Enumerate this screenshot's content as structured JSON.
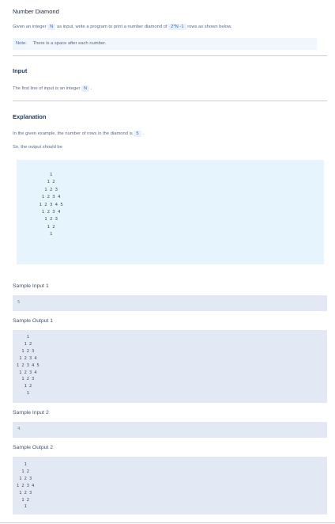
{
  "problem": {
    "title": "Number Diamond",
    "desc_prefix": "Given an integer",
    "desc_var": "N",
    "desc_middle": "as input, write a program to print a number diamond of",
    "desc_formula": "2*N -1",
    "desc_suffix": "rows as shown below.",
    "note_label": "Note:",
    "note_text": "There is a space after each number."
  },
  "input_section": {
    "heading": "Input",
    "text_prefix": "The first line of input is an integer",
    "text_var": "N",
    "text_suffix": "."
  },
  "explanation": {
    "heading": "Explanation",
    "line1_prefix": "In the given example, the number of rows in the diamond is",
    "line1_value": "5",
    "line1_suffix": ".",
    "line2": "So, the output should be",
    "diamond": "        1\n       1 2\n      1 2 3\n     1 2 3 4\n    1 2 3 4 5\n     1 2 3 4\n      1 2 3\n       1 2\n        1"
  },
  "samples": {
    "input1_label": "Sample Input 1",
    "input1_value": "5",
    "output1_label": "Sample Output 1",
    "output1_value": "    1\n   1 2\n  1 2 3\n 1 2 3 4\n1 2 3 4 5\n 1 2 3 4\n  1 2 3\n   1 2\n    1",
    "input2_label": "Sample Input 2",
    "input2_value": "4",
    "output2_label": "Sample Output 2",
    "output2_value": "   1\n  1 2\n 1 2 3\n1 2 3 4\n 1 2 3\n  1 2\n   1"
  }
}
